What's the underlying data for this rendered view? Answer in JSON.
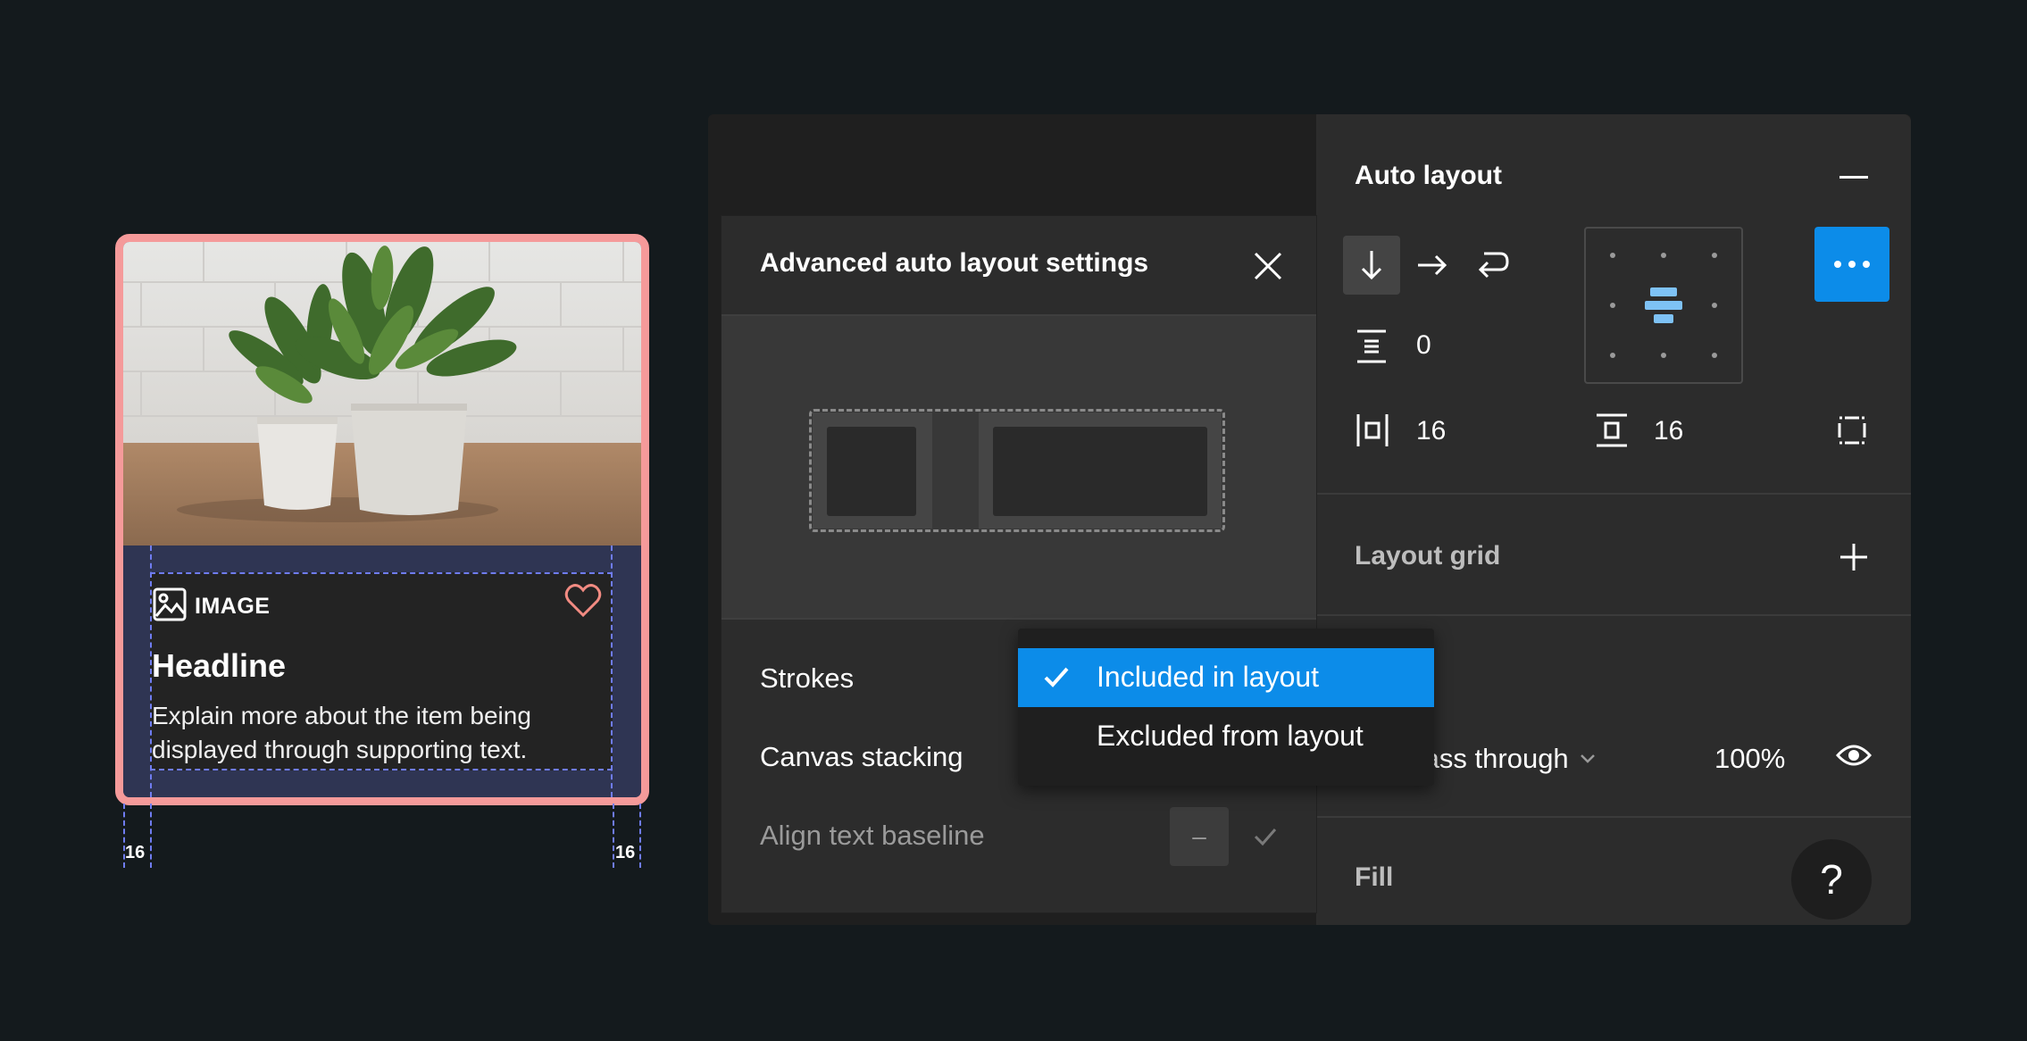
{
  "card": {
    "tag": "IMAGE",
    "headline": "Headline",
    "supporting_text": "Explain more about the item being displayed through supporting text.",
    "padding_left": "16",
    "padding_right": "16",
    "icons": {
      "tag": "image-icon",
      "favorite": "heart-icon"
    }
  },
  "right_panel": {
    "auto_layout_title": "Auto layout",
    "spacing_value": "0",
    "horizontal_padding": "16",
    "vertical_padding": "16",
    "layout_grid_title": "Layout grid",
    "blend_mode": "Pass through",
    "opacity": "100%",
    "fill_title": "Fill",
    "help_label": "?"
  },
  "modal": {
    "title": "Advanced auto layout settings",
    "strokes_label": "Strokes",
    "canvas_stacking_label": "Canvas stacking",
    "align_baseline_label": "Align text baseline",
    "align_baseline_toggle": "–"
  },
  "dropdown": {
    "options": [
      "Included in layout",
      "Excluded from layout"
    ],
    "selected": "Included in layout"
  },
  "colors": {
    "background": "#141a1d",
    "card_border": "#f59a9a",
    "accent_blue": "#0c8ce9",
    "heart": "#f28b82",
    "guide_dash": "#6f7cf0"
  }
}
